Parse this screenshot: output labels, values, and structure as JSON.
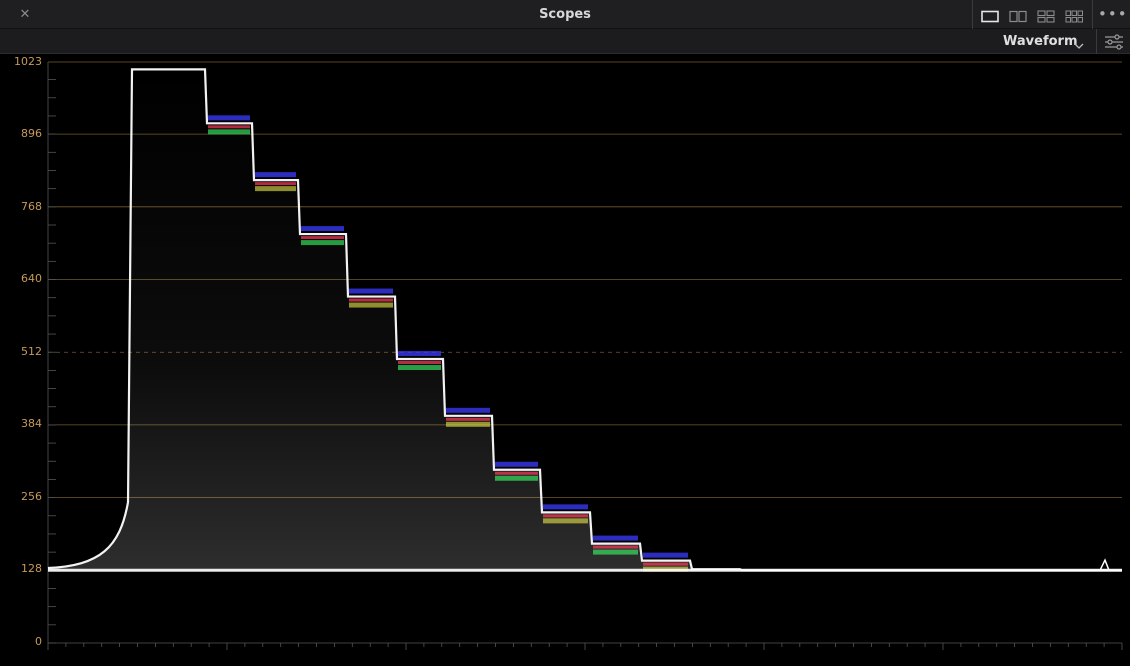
{
  "window": {
    "title": "Scopes",
    "close_glyph": "✕",
    "more_glyph": "•••"
  },
  "toolbar": {
    "scope_type": "Waveform",
    "layout_icons": [
      "single-view-icon",
      "dual-view-icon",
      "quad-view-icon",
      "six-view-icon"
    ],
    "settings_icon": "sliders-icon"
  },
  "scope": {
    "y_axis_labels": [
      "1023",
      "896",
      "768",
      "640",
      "512",
      "384",
      "256",
      "128",
      "0"
    ],
    "colors": {
      "background": "#000000",
      "grid_line": "#8a6a32",
      "axis_label": "#c79a5b",
      "trace": "#ffffff",
      "tint_blue": "#3b3bff",
      "tint_red": "#ff3b5b",
      "tint_green": "#3bff6b",
      "tint_yellow": "#e8e84a"
    }
  },
  "chart_data": {
    "type": "line",
    "title": "",
    "xlabel": "",
    "ylabel": "",
    "ylim": [
      0,
      1023
    ],
    "y_ticks": [
      0,
      128,
      256,
      384,
      512,
      640,
      768,
      896,
      1023
    ],
    "grid": true,
    "series": [
      {
        "values_description_steps": [
          1010,
          915,
          815,
          720,
          610,
          500,
          400,
          305,
          230,
          175,
          145,
          130,
          128
        ]
      }
    ]
  }
}
